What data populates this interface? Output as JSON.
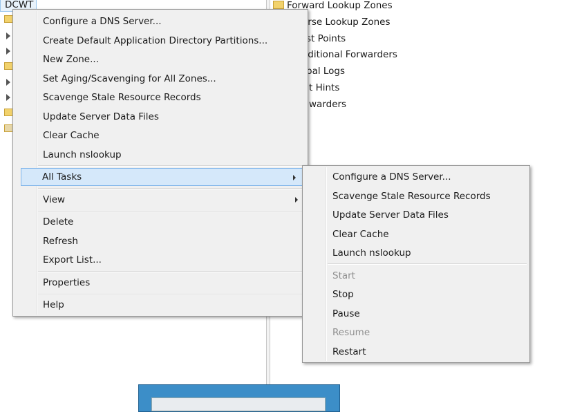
{
  "tree": {
    "server_node": "DCWT"
  },
  "right_pane": {
    "items": [
      "Forward Lookup Zones",
      "erse Lookup Zones",
      "st Points",
      "aditional Forwarders",
      "bal Logs",
      "t Hints",
      "warders"
    ]
  },
  "context_menu": {
    "items": [
      "Configure a DNS Server...",
      "Create Default Application Directory Partitions...",
      "New Zone...",
      "Set Aging/Scavenging for All Zones...",
      "Scavenge Stale Resource Records",
      "Update Server Data Files",
      "Clear Cache",
      "Launch nslookup",
      "All Tasks",
      "View",
      "Delete",
      "Refresh",
      "Export List...",
      "Properties",
      "Help"
    ]
  },
  "submenu": {
    "items": [
      "Configure a DNS Server...",
      "Scavenge Stale Resource Records",
      "Update Server Data Files",
      "Clear Cache",
      "Launch nslookup",
      "Start",
      "Stop",
      "Pause",
      "Resume",
      "Restart"
    ]
  }
}
